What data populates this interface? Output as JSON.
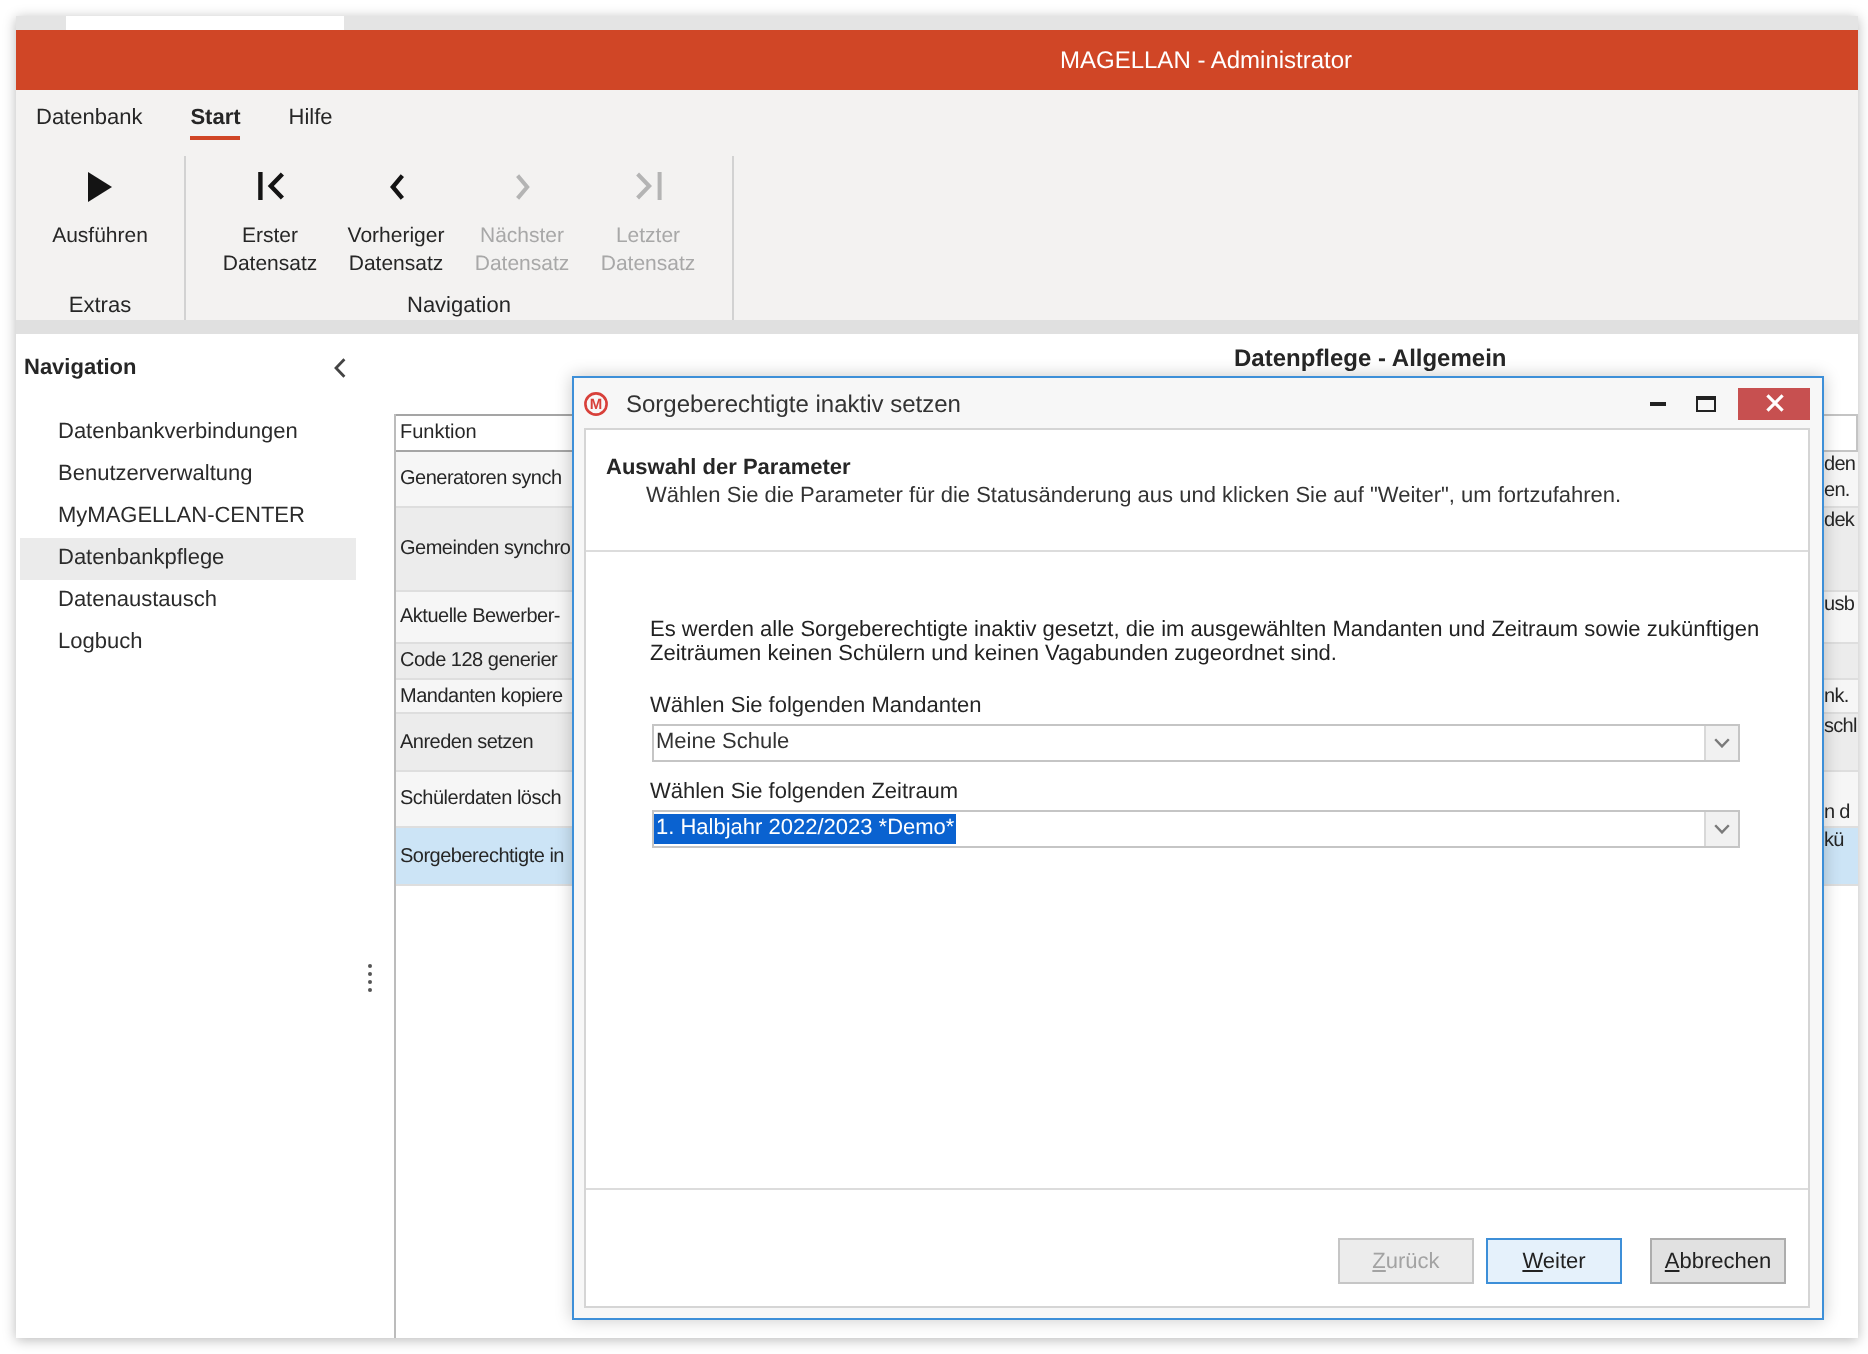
{
  "window": {
    "title": "MAGELLAN - Administrator"
  },
  "ribbon": {
    "tabs": [
      {
        "label": "Datenbank",
        "selected": false
      },
      {
        "label": "Start",
        "selected": true
      },
      {
        "label": "Hilfe",
        "selected": false
      }
    ],
    "groups": [
      {
        "label": "Extras",
        "buttons": [
          {
            "kind": "run",
            "label": "Ausführen",
            "disabled": false
          }
        ]
      },
      {
        "label": "Navigation",
        "buttons": [
          {
            "kind": "first",
            "label": "Erster Datensatz",
            "disabled": false
          },
          {
            "kind": "previous",
            "label": "Vorheriger Datensatz",
            "disabled": false
          },
          {
            "kind": "next",
            "label": "Nächster Datensatz",
            "disabled": true
          },
          {
            "kind": "last",
            "label": "Letzter Datensatz",
            "disabled": true
          }
        ]
      }
    ]
  },
  "navigation": {
    "title": "Navigation",
    "items": [
      {
        "label": "Datenbankverbindungen",
        "selected": false
      },
      {
        "label": "Benutzerverwaltung",
        "selected": false
      },
      {
        "label": "MyMAGELLAN-CENTER",
        "selected": false
      },
      {
        "label": "Datenbankpflege",
        "selected": true
      },
      {
        "label": "Datenaustausch",
        "selected": false
      },
      {
        "label": "Logbuch",
        "selected": false
      }
    ]
  },
  "content": {
    "heading": "Datenpflege - Allgemein",
    "table": {
      "columns": [
        "Funktion"
      ],
      "rows": [
        {
          "function": "Generatoren synch",
          "column_2": [
            "den",
            "en."
          ],
          "selected": false
        },
        {
          "function": "Gemeinden synchro",
          "column_2": [
            "dek"
          ],
          "selected": false
        },
        {
          "function": "Aktuelle Bewerber-",
          "column_2": [
            "usb"
          ],
          "selected": false
        },
        {
          "function": "Code 128 generier",
          "selected": false
        },
        {
          "function": "Mandanten kopiere",
          "column_2": [
            "nk."
          ],
          "selected": false
        },
        {
          "function": "Anreden setzen",
          "column_2": [
            "schl"
          ],
          "selected": false
        },
        {
          "function": "Schülerdaten lösch",
          "column_2": [
            "n d"
          ],
          "selected": false
        },
        {
          "function": "Sorgeberechtigte in",
          "column_2": [
            "kü"
          ],
          "selected": true
        }
      ]
    }
  },
  "dialog": {
    "logo_text": "M",
    "title": "Sorgeberechtigte inaktiv setzen",
    "header": {
      "title": "Auswahl der Parameter",
      "subtitle": "Wählen Sie die Parameter für die Statusänderung aus und klicken Sie auf \"Weiter\", um fortzufahren."
    },
    "description": "Es werden alle Sorgeberechtigte inaktiv gesetzt, die im ausgewählten Mandanten und Zeitraum sowie zukünftigen Zeiträumen keinen Schülern und keinen Vagabunden zugeordnet sind.",
    "fields": [
      {
        "label": "Wählen Sie folgenden Mandanten",
        "value": "Meine Schule",
        "highlighted": false
      },
      {
        "label": "Wählen Sie folgenden Zeitraum",
        "value": "1. Halbjahr 2022/2023 *Demo*",
        "highlighted": true
      }
    ],
    "buttons": [
      {
        "kind": "back",
        "label": "Zurück",
        "disabled": true,
        "default": false,
        "access_key_underlined": true
      },
      {
        "kind": "next",
        "label": "Weiter",
        "disabled": false,
        "default": true,
        "access_key_underlined": true
      },
      {
        "kind": "cancel",
        "label": "Abbrechen",
        "disabled": false,
        "default": false,
        "access_key_underlined": true
      }
    ]
  }
}
